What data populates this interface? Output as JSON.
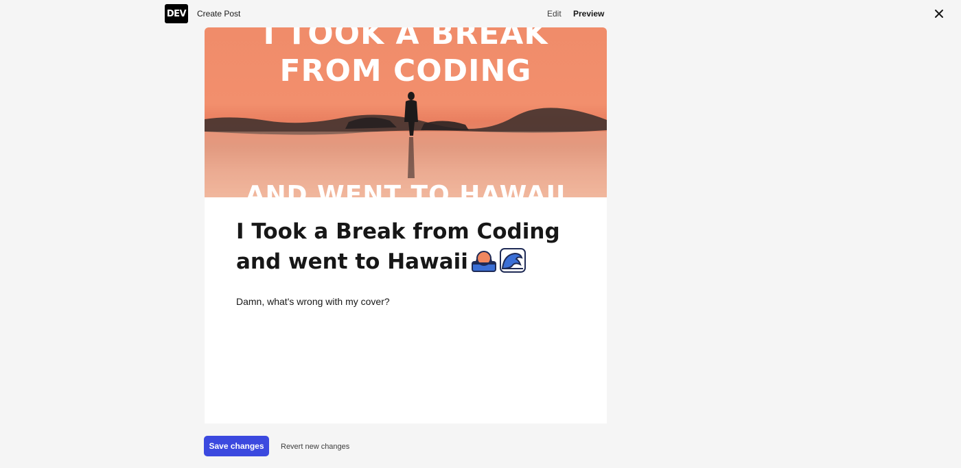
{
  "header": {
    "logo_text": "DEV",
    "page_title": "Create Post",
    "mode_edit": "Edit",
    "mode_preview": "Preview",
    "close_icon": "close-icon"
  },
  "cover": {
    "line1": "I TOOK A BREAK",
    "line2": "FROM CODING",
    "line3": "AND WENT TO HAWAII"
  },
  "post": {
    "title": "I Took a Break from Coding and went to Hawaii",
    "title_emojis": [
      "sunset-icon",
      "wave-icon"
    ],
    "body": "Damn, what's wrong with my cover?"
  },
  "actions": {
    "save_label": "Save changes",
    "revert_label": "Revert new changes"
  },
  "colors": {
    "accent": "#3b49df",
    "background": "#f5f5f5"
  }
}
